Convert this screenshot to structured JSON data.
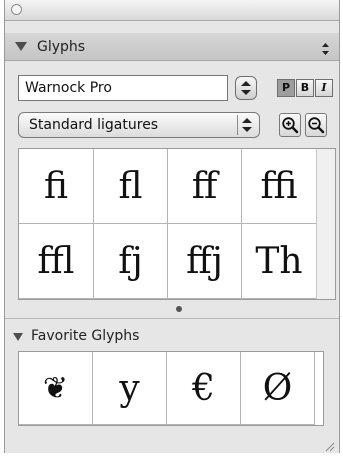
{
  "panel": {
    "title": "Glyphs"
  },
  "font": {
    "family": "Warnock Pro",
    "styles": [
      "P",
      "B",
      "I"
    ],
    "active_style": "P"
  },
  "feature": {
    "selected": "Standard ligatures"
  },
  "glyphs": [
    "ﬁ",
    "ﬂ",
    "ﬀ",
    "ﬃ",
    "ﬄ",
    "fj",
    "ffj",
    "Th"
  ],
  "favorites": {
    "title": "Favorite Glyphs",
    "items": [
      "❦",
      "y",
      "€",
      "Ø"
    ]
  }
}
